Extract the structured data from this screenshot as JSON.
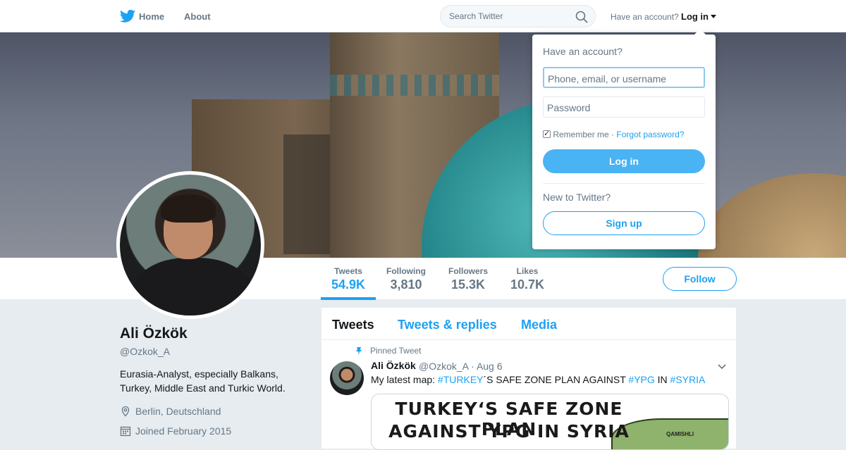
{
  "nav": {
    "home": "Home",
    "about": "About",
    "search_placeholder": "Search Twitter",
    "have_account": "Have an account?",
    "login": "Log in"
  },
  "profile": {
    "name": "Ali Özkök",
    "handle": "@Ozkok_A",
    "bio": "Eurasia-Analyst, especially Balkans, Turkey, Middle East and Turkic World.",
    "location": "Berlin, Deutschland",
    "joined": "Joined February 2015",
    "follow_label": "Follow"
  },
  "stats": [
    {
      "label": "Tweets",
      "value": "54.9K"
    },
    {
      "label": "Following",
      "value": "3,810"
    },
    {
      "label": "Followers",
      "value": "15.3K"
    },
    {
      "label": "Likes",
      "value": "10.7K"
    }
  ],
  "tabs": [
    "Tweets",
    "Tweets & replies",
    "Media"
  ],
  "tweet": {
    "pinned_label": "Pinned Tweet",
    "name": "Ali Özkök",
    "handle": "@Ozkok_A",
    "sep": "·",
    "date": "Aug 6",
    "text_1": "My latest map: ",
    "hashtag_1": "#TURKEY",
    "text_2": "´S SAFE ZONE PLAN AGAINST ",
    "hashtag_2": "#YPG",
    "text_3": " IN ",
    "hashtag_3": "#SYRIA",
    "media_line_1": "TURKEY‘S SAFE ZONE PLAN",
    "media_line_2": "AGAINST YPG IN SYRIA",
    "media_city": "QAMISHLI"
  },
  "login_dropdown": {
    "title": "Have an account?",
    "username_placeholder": "Phone, email, or username",
    "password_placeholder": "Password",
    "remember": "Remember me",
    "dot": "·",
    "forgot": "Forgot password?",
    "login_button": "Log in",
    "new_to": "New to Twitter?",
    "signup_button": "Sign up"
  },
  "colors": {
    "accent": "#1da1f2",
    "login_button": "#4ab3f4",
    "text": "#14171a",
    "muted": "#657786",
    "background": "#e6ecf0"
  },
  "icons": [
    "twitter-bird-icon",
    "search-icon",
    "caret-down-icon",
    "location-pin-icon",
    "calendar-icon",
    "pin-icon",
    "chevron-down-icon",
    "checkbox-checked"
  ]
}
